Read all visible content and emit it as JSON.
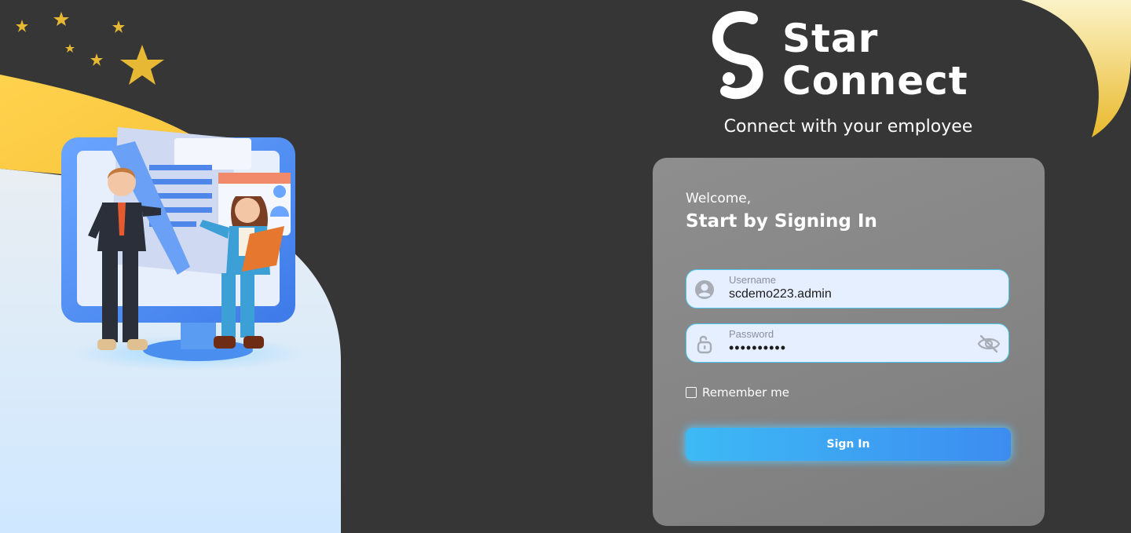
{
  "brand": {
    "name_line1": "Star",
    "name_line2": "Connect",
    "tagline": "Connect with your employee",
    "logo_icon": "star-connect-s-logo"
  },
  "login": {
    "welcome": "Welcome,",
    "title": "Start by Signing In",
    "username": {
      "label": "Username",
      "value": "scdemo223.admin",
      "icon": "user-circle-icon"
    },
    "password": {
      "label": "Password",
      "value": "••••••••••",
      "icon": "unlock-icon",
      "toggle_icon": "eye-off-icon"
    },
    "remember_label": "Remember me",
    "remember_checked": false,
    "submit_label": "Sign In"
  },
  "colors": {
    "background": "#363636",
    "card": "#8a8a8a",
    "accent": "#3dbaf5",
    "star": "#e6b833",
    "input_bg": "#e6efff"
  }
}
